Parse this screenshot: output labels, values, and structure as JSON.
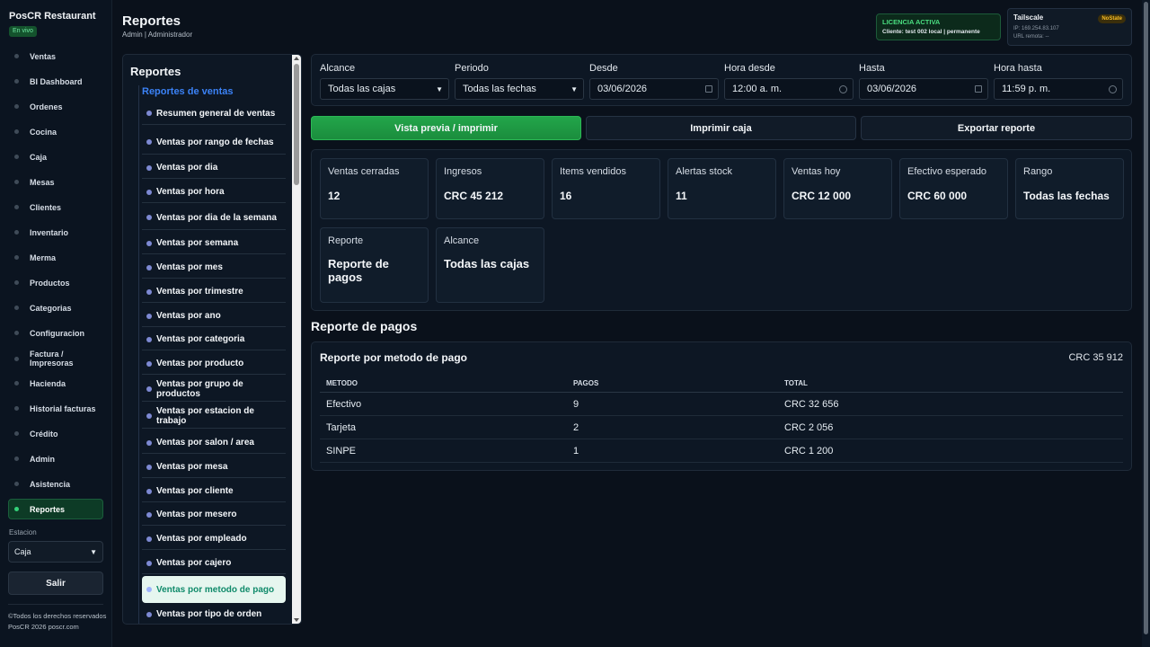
{
  "app": {
    "brand": "PosCR Restaurant",
    "live_badge": "En vivo"
  },
  "sidebar": {
    "items": [
      {
        "label": "Ventas"
      },
      {
        "label": "BI Dashboard"
      },
      {
        "label": "Ordenes"
      },
      {
        "label": "Cocina"
      },
      {
        "label": "Caja"
      },
      {
        "label": "Mesas"
      },
      {
        "label": "Clientes"
      },
      {
        "label": "Inventario"
      },
      {
        "label": "Merma"
      },
      {
        "label": "Productos"
      },
      {
        "label": "Categorias"
      },
      {
        "label": "Configuracion"
      },
      {
        "label": "Factura / Impresoras"
      },
      {
        "label": "Hacienda"
      },
      {
        "label": "Historial facturas"
      },
      {
        "label": "Crédito"
      },
      {
        "label": "Admin"
      },
      {
        "label": "Asistencia"
      },
      {
        "label": "Reportes"
      }
    ],
    "active": "Reportes",
    "station_label": "Estacion",
    "station_value": "Caja",
    "logout": "Salir",
    "copyright": "©Todos los derechos reservados PosCR 2026 poscr.com"
  },
  "header": {
    "title": "Reportes",
    "subtitle": "Admin | Administrador",
    "license_title": "LICENCIA ACTIVA",
    "license_detail": "Cliente: test 002 local | permanente",
    "tailscale_title": "Tailscale",
    "tailscale_badge": "NoState",
    "tailscale_ip": "IP: 169.254.83.107",
    "tailscale_url": "URL remota: --"
  },
  "reports_panel": {
    "title": "Reportes",
    "group": "Reportes de ventas",
    "items": [
      "Resumen general de ventas",
      "Ventas por rango de fechas",
      "Ventas por dia",
      "Ventas por hora",
      "Ventas por dia de la semana",
      "Ventas por semana",
      "Ventas por mes",
      "Ventas por trimestre",
      "Ventas por ano",
      "Ventas por categoria",
      "Ventas por producto",
      "Ventas por grupo de productos",
      "Ventas por estacion de trabajo",
      "Ventas por salon / area",
      "Ventas por mesa",
      "Ventas por cliente",
      "Ventas por mesero",
      "Ventas por empleado",
      "Ventas por cajero",
      "Ventas por metodo de pago",
      "Ventas por tipo de orden"
    ],
    "active": "Ventas por metodo de pago"
  },
  "filters": {
    "alcance": {
      "label": "Alcance",
      "value": "Todas las cajas"
    },
    "periodo": {
      "label": "Periodo",
      "value": "Todas las fechas"
    },
    "desde": {
      "label": "Desde",
      "value": "03/06/2026"
    },
    "hora_desde": {
      "label": "Hora desde",
      "value": "12:00 a. m."
    },
    "hasta": {
      "label": "Hasta",
      "value": "03/06/2026"
    },
    "hora_hasta": {
      "label": "Hora hasta",
      "value": "11:59 p. m."
    }
  },
  "actions": {
    "preview": "Vista previa / imprimir",
    "print_box": "Imprimir caja",
    "export": "Exportar reporte"
  },
  "kpis": [
    {
      "label": "Ventas cerradas",
      "value": "12"
    },
    {
      "label": "Ingresos",
      "value": "CRC 45 212"
    },
    {
      "label": "Items vendidos",
      "value": "16"
    },
    {
      "label": "Alertas stock",
      "value": "11"
    },
    {
      "label": "Ventas hoy",
      "value": "CRC 12 000"
    },
    {
      "label": "Efectivo esperado",
      "value": "CRC 60 000"
    },
    {
      "label": "Rango",
      "value": "Todas las fechas"
    },
    {
      "label": "Reporte",
      "value": "Reporte de pagos"
    },
    {
      "label": "Alcance",
      "value": "Todas las cajas"
    }
  ],
  "section": {
    "title": "Reporte de pagos",
    "table_title": "Reporte por metodo de pago",
    "table_total": "CRC 35 912",
    "columns": [
      "METODO",
      "PAGOS",
      "TOTAL"
    ],
    "rows": [
      [
        "Efectivo",
        "9",
        "CRC 32 656"
      ],
      [
        "Tarjeta",
        "2",
        "CRC 2 056"
      ],
      [
        "SINPE",
        "1",
        "CRC 1 200"
      ]
    ]
  }
}
